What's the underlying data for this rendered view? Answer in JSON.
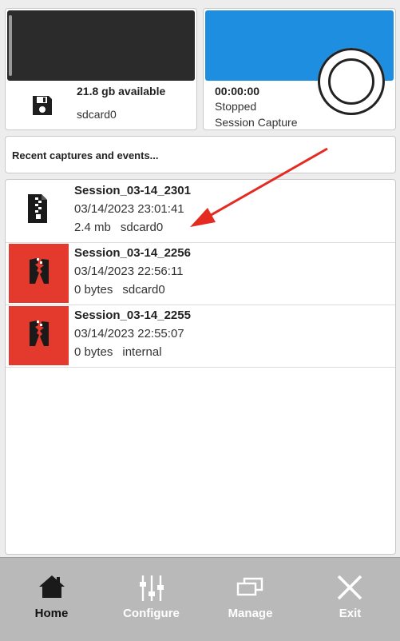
{
  "storage": {
    "available": "21.8 gb available",
    "device": "sdcard0"
  },
  "capture": {
    "time": "00:00:00",
    "status": "Stopped",
    "mode": "Session Capture"
  },
  "recent": {
    "title": "Recent captures and events..."
  },
  "sessions": [
    {
      "name": "Session_03-14_2301",
      "datetime": "03/14/2023 23:01:41",
      "size": "2.4 mb",
      "location": "sdcard0",
      "icon": "zip-file-icon",
      "style": "normal"
    },
    {
      "name": "Session_03-14_2256",
      "datetime": "03/14/2023 22:56:11",
      "size": "0 bytes",
      "location": "sdcard0",
      "icon": "broken-zip-icon",
      "style": "error"
    },
    {
      "name": "Session_03-14_2255",
      "datetime": "03/14/2023 22:55:07",
      "size": "0 bytes",
      "location": "internal",
      "icon": "broken-zip-icon",
      "style": "error"
    }
  ],
  "nav": {
    "home": "Home",
    "configure": "Configure",
    "manage": "Manage",
    "exit": "Exit"
  },
  "colors": {
    "capture_banner": "#1e8fe0",
    "error_thumb": "#e43a2d",
    "storage_bar": "#2b2b2b",
    "nav_bg": "#b9b9b9",
    "annotation_arrow": "#e32b22"
  }
}
